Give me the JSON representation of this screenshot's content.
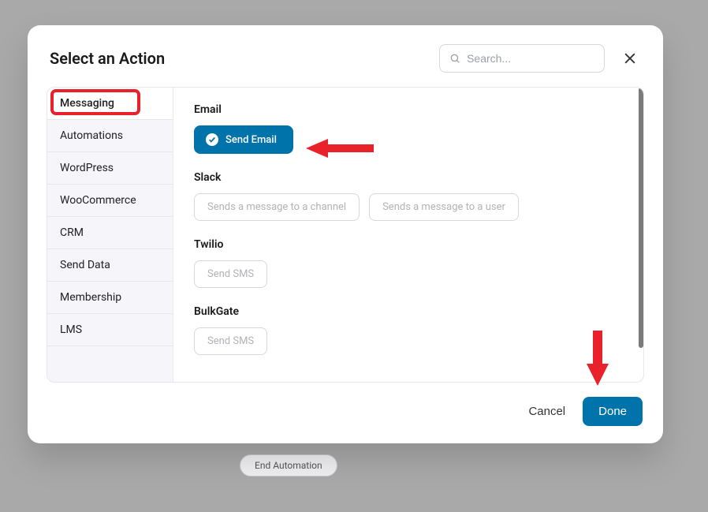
{
  "backdrop_pill": "End Automation",
  "modal": {
    "title": "Select an Action",
    "search_placeholder": "Search...",
    "sidebar": [
      {
        "label": "Messaging",
        "active": true
      },
      {
        "label": "Automations",
        "active": false
      },
      {
        "label": "WordPress",
        "active": false
      },
      {
        "label": "WooCommerce",
        "active": false
      },
      {
        "label": "CRM",
        "active": false
      },
      {
        "label": "Send Data",
        "active": false
      },
      {
        "label": "Membership",
        "active": false
      },
      {
        "label": "LMS",
        "active": false
      }
    ],
    "groups": [
      {
        "title": "Email",
        "actions": [
          {
            "label": "Send Email",
            "selected": true
          }
        ]
      },
      {
        "title": "Slack",
        "actions": [
          {
            "label": "Sends a message to a channel",
            "selected": false
          },
          {
            "label": "Sends a message to a user",
            "selected": false
          }
        ]
      },
      {
        "title": "Twilio",
        "actions": [
          {
            "label": "Send SMS",
            "selected": false
          }
        ]
      },
      {
        "title": "BulkGate",
        "actions": [
          {
            "label": "Send SMS",
            "selected": false
          }
        ]
      }
    ],
    "footer": {
      "cancel": "Cancel",
      "done": "Done"
    }
  }
}
